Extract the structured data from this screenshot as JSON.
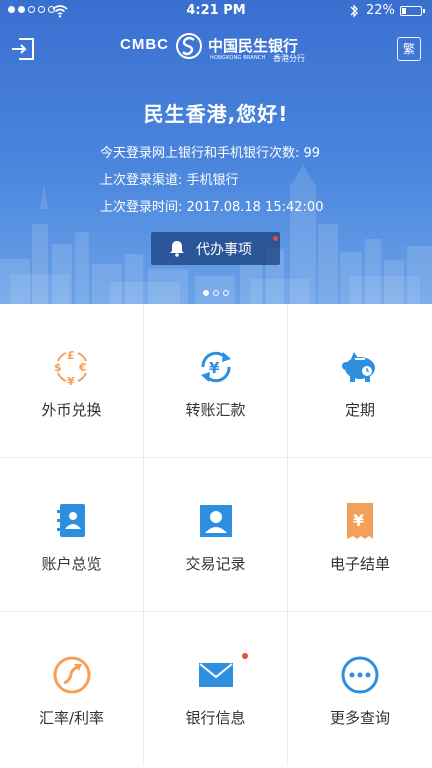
{
  "status_bar": {
    "time": "4:21 PM",
    "battery_level": "22%",
    "battery_fraction": 0.22
  },
  "header": {
    "brand_latin": "CMBC",
    "brand_chinese": "中国民生银行",
    "branch_english": "HONGKONG BRANCH",
    "branch_chinese": "香港分行",
    "language_toggle": "繁",
    "greeting": "民生香港,您好!",
    "login_count_text": "今天登录网上银行和手机银行次数: 99",
    "last_channel_text": "上次登录渠道: 手机银行",
    "last_time_text": "上次登录时间: 2017.08.18 15:42:00",
    "todo_label": "代办事项",
    "carousel_pages": 3,
    "carousel_active": 1
  },
  "menu": {
    "items": [
      {
        "label": "外币兑换",
        "icon": "currency-exchange-icon"
      },
      {
        "label": "转账汇款",
        "icon": "transfer-icon"
      },
      {
        "label": "定期",
        "icon": "piggy-bank-icon"
      },
      {
        "label": "账户总览",
        "icon": "account-book-icon"
      },
      {
        "label": "交易记录",
        "icon": "transaction-record-icon"
      },
      {
        "label": "电子结单",
        "icon": "e-statement-icon"
      },
      {
        "label": "汇率/利率",
        "icon": "rate-icon"
      },
      {
        "label": "银行信息",
        "icon": "mail-icon"
      },
      {
        "label": "更多查询",
        "icon": "more-icon"
      }
    ]
  },
  "colors": {
    "orange": "#f5a05a",
    "blue": "#2e8fe0",
    "header_blue": "#4b86dd",
    "badge_red": "#e74b3c"
  }
}
